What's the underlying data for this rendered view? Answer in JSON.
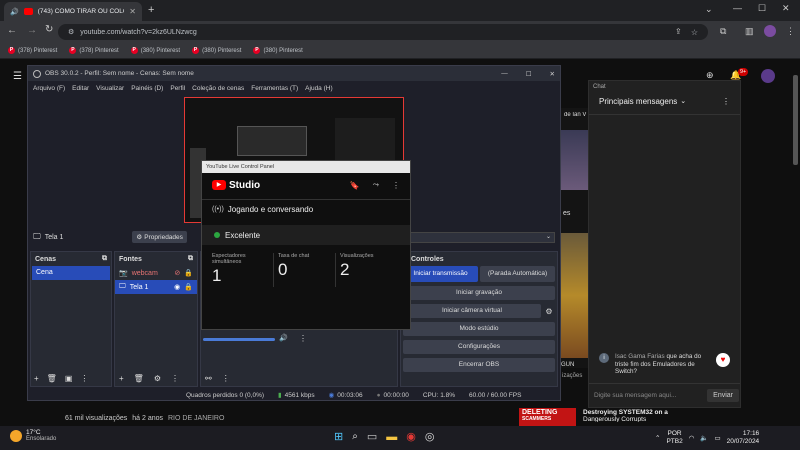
{
  "browser": {
    "tab_title": "(743) COMO TIRAR OU COLOC",
    "url": "youtube.com/watch?v=2kz6ULNzwcg",
    "bookmarks": [
      "(378) Pinterest",
      "(378) Pinterest",
      "(380) Pinterest",
      "(380) Pinterest",
      "(380) Pinterest"
    ]
  },
  "obs": {
    "title": "OBS 30.0.2 - Perfil: Sem nome - Cenas: Sem nome",
    "menu": [
      "Arquivo (F)",
      "Editar",
      "Visualizar",
      "Painéis (D)",
      "Perfil",
      "Coleção de cenas",
      "Ferramentas (T)",
      "Ajuda (H)"
    ],
    "source_label": "Tela 1",
    "properties": "Propriedades",
    "scenes_title": "Cenas",
    "scene_item": "Cena",
    "sources_title": "Fontes",
    "sources": [
      "webcam",
      "Tela 1"
    ],
    "controls_title": "Controles",
    "controls": {
      "start_stream": "Iniciar transmissão",
      "stop_auto": "(Parada Automática)",
      "record": "Iniciar gravação",
      "virtual_cam": "Iniciar câmera virtual",
      "studio": "Modo estúdio",
      "settings": "Configurações",
      "exit": "Encerrar OBS"
    },
    "status": {
      "dropped": "Quadros perdidos 0 (0,0%)",
      "kbps": "4561 kbps",
      "stream_time": "00:03:06",
      "rec_time": "00:00:00",
      "cpu": "CPU: 1.8%",
      "fps": "60.00 / 60.00 FPS"
    }
  },
  "panel": {
    "window_title": "YouTube Live Control Panel",
    "logo_text": "Studio",
    "stream_title": "Jogando e conversando",
    "health": "Excelente",
    "stats": [
      {
        "label": "Espectadores simultâneos",
        "value": "1"
      },
      {
        "label": "Taxa de chat",
        "value": "0"
      },
      {
        "label": "Visualizações",
        "value": "2"
      }
    ]
  },
  "youtube": {
    "views": "61 mil visualizações",
    "ago": "há 2 anos",
    "location": "RIO DE JANEIRO",
    "channel_partial": "de Ian V",
    "side_partial": "es",
    "gun_partial": "GUN",
    "views_partial": "izações",
    "rec_title": "Destroying SYSTEM32 on a",
    "rec_sub": "Dangerously Corrupts",
    "rec_thumb": "DELETING",
    "rec_thumb2": "SCAMMERS",
    "notif_count": "9+"
  },
  "chat": {
    "header": "Chat",
    "top": "Principais mensagens",
    "author": "Isac Gama Farias",
    "message": "que acha do triste fim dos Emuladores de Switch?",
    "placeholder": "Digite sua mensagem aqui...",
    "send": "Enviar"
  },
  "taskbar": {
    "weather_temp": "17°C",
    "weather_desc": "Ensolarado",
    "lang": "POR",
    "layout": "PTB2",
    "time": "17:16",
    "date": "20/07/2024"
  }
}
